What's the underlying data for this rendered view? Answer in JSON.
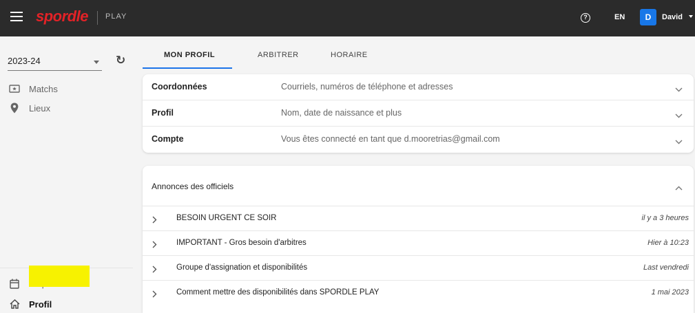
{
  "topbar": {
    "brand": "spordle",
    "brand_sub": "PLAY",
    "language": "EN",
    "user_initial": "D",
    "user_name": "David"
  },
  "sidebar": {
    "season": "2023-24",
    "items": [
      {
        "label": "Matchs",
        "icon": "ticket-icon"
      },
      {
        "label": "Lieux",
        "icon": "location-pin-icon"
      }
    ],
    "bottom_items": [
      {
        "label": "Disponib...",
        "icon": "calendar-icon"
      },
      {
        "label": "Profil",
        "icon": "home-icon"
      }
    ]
  },
  "tabs": [
    {
      "label": "MON PROFIL",
      "active": true
    },
    {
      "label": "ARBITRER",
      "active": false
    },
    {
      "label": "HORAIRE",
      "active": false
    }
  ],
  "profile_sections": [
    {
      "title": "Coordonnées",
      "description": "Courriels, numéros de téléphone et adresses"
    },
    {
      "title": "Profil",
      "description": "Nom, date de naissance et plus"
    },
    {
      "title": "Compte",
      "description": "Vous êtes connecté en tant que d.mooretrias@gmail.com"
    }
  ],
  "announcements": {
    "header": "Annonces des officiels",
    "items": [
      {
        "title": "BESOIN URGENT CE SOIR",
        "date": "il y a 3 heures"
      },
      {
        "title": "IMPORTANT - Gros besoin d'arbitres",
        "date": "Hier à 10:23"
      },
      {
        "title": "Groupe d'assignation et disponibilités",
        "date": "Last vendredi"
      },
      {
        "title": "Comment mettre des disponibilités dans SPORDLE PLAY",
        "date": "1 mai 2023"
      }
    ]
  },
  "colors": {
    "topbar": "#2b2b2b",
    "brand": "#e32227",
    "accent": "#1a73e8",
    "avatar": "#1877e8",
    "redaction": "#f7f200"
  }
}
